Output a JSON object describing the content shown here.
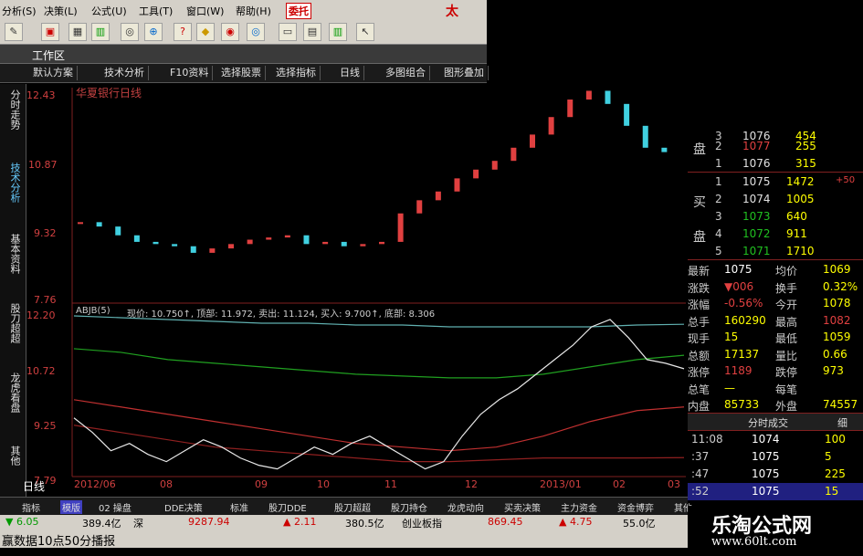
{
  "menu": [
    "分析(S)",
    "决策(L)",
    "公式(U)",
    "工具(T)",
    "窗口(W)",
    "帮助(H)"
  ],
  "menu_highlight": "委托",
  "brand_char": "太",
  "workbar_title": "工作区",
  "func_tabs": [
    "默认方案",
    "技术分析",
    "F10资料",
    "选择股票",
    "选择指标",
    "日线",
    "多图组合",
    "图形叠加"
  ],
  "left_tabs": [
    "分时走势",
    "技术分析",
    "基本资料",
    "股刀超超",
    "龙虎看盘",
    "其他"
  ],
  "chart": {
    "title": "华夏银行日线",
    "price_ticks": [
      "12.43",
      "10.87",
      "9.32",
      "7.76"
    ],
    "ind_ticks": [
      "12.20",
      "10.72",
      "9.25",
      "7.79"
    ],
    "ind_label": "ABJB(5)",
    "ind_values": "现价: 10.750↑, 顶部: 11.972, 卖出: 11.124, 买入: 9.700↑, 底部: 8.306",
    "date_labels": [
      "2012/06",
      "08",
      "09",
      "10",
      "11",
      "12",
      "2013/01",
      "02",
      "03"
    ],
    "period_label": "日线"
  },
  "chart_data": {
    "type": "line",
    "title": "",
    "candles_close": [
      9.4,
      9.3,
      9.1,
      8.95,
      8.9,
      8.85,
      8.7,
      8.8,
      8.9,
      9.0,
      9.05,
      9.1,
      8.9,
      8.95,
      8.85,
      8.9,
      8.95,
      9.6,
      9.9,
      10.1,
      10.4,
      10.6,
      10.8,
      11.1,
      11.4,
      11.8,
      12.2,
      12.4,
      12.1,
      11.6,
      11.1,
      11.0
    ],
    "line_current": [
      9.4,
      9.0,
      8.5,
      8.7,
      8.4,
      8.2,
      8.5,
      8.8,
      8.6,
      8.3,
      8.1,
      8.0,
      8.3,
      8.6,
      8.4,
      8.7,
      8.9,
      8.6,
      8.3,
      8.0,
      8.2,
      8.9,
      9.5,
      9.9,
      10.2,
      10.6,
      11.0,
      11.4,
      11.9,
      12.1,
      11.6,
      11.0,
      10.9,
      10.75
    ],
    "line_top": [
      12.2,
      12.15,
      12.1,
      12.05,
      12.0,
      12.0,
      11.95,
      11.95,
      11.9,
      11.9,
      11.9,
      11.9,
      11.95,
      11.97
    ],
    "line_sell": [
      11.3,
      11.2,
      11.0,
      10.9,
      10.8,
      10.7,
      10.6,
      10.55,
      10.5,
      10.5,
      10.6,
      10.8,
      11.0,
      11.12
    ],
    "line_buy": [
      9.9,
      9.7,
      9.5,
      9.3,
      9.1,
      8.9,
      8.7,
      8.6,
      8.5,
      8.6,
      8.9,
      9.3,
      9.6,
      9.7
    ],
    "line_bottom": [
      9.2,
      9.0,
      8.8,
      8.6,
      8.5,
      8.4,
      8.3,
      8.2,
      8.2,
      8.25,
      8.3,
      8.3,
      8.3,
      8.31
    ],
    "ylim": [
      7.79,
      12.2
    ]
  },
  "quotes": {
    "sell_label": "卖",
    "sell_pan": "盘",
    "sell": [
      [
        "3",
        "1076",
        "454"
      ],
      [
        "2",
        "1077",
        "255"
      ],
      [
        "1",
        "1076",
        "315"
      ]
    ],
    "buy_label": "买",
    "buy_pan": "盘",
    "buy": [
      [
        "1",
        "1075",
        "1472",
        "+50"
      ],
      [
        "2",
        "1074",
        "1005",
        ""
      ],
      [
        "3",
        "1073",
        "640",
        ""
      ],
      [
        "4",
        "1072",
        "911",
        ""
      ],
      [
        "5",
        "1071",
        "1710",
        ""
      ]
    ],
    "stats": [
      [
        "最新",
        "1075",
        "均价",
        "1069"
      ],
      [
        "涨跌",
        "▼006",
        "换手",
        "0.32%"
      ],
      [
        "涨幅",
        "-0.56%",
        "今开",
        "1078"
      ],
      [
        "总手",
        "160290",
        "最高",
        "1082"
      ],
      [
        "现手",
        "15",
        "最低",
        "1059"
      ],
      [
        "总额",
        "17137",
        "量比",
        "0.66"
      ],
      [
        "涨停",
        "1189",
        "跌停",
        "973"
      ],
      [
        "总笔",
        "—",
        "每笔",
        ""
      ],
      [
        "内盘",
        "85733",
        "外盘",
        "74557"
      ]
    ],
    "ticks_header": "分时成交",
    "ticks_detail": "细",
    "ticks": [
      [
        "11:08",
        "1074",
        "100"
      ],
      [
        ":37",
        "1075",
        "5"
      ],
      [
        ":47",
        "1075",
        "225"
      ],
      [
        ":52",
        "1075",
        "15"
      ]
    ]
  },
  "bottom_tabs": [
    "指标",
    "模版",
    "02 操盘",
    "DDE决策",
    "标准",
    "股刀DDE",
    "股刀超超",
    "股刀持仓",
    "龙虎动向",
    "买卖决策",
    "主力资金",
    "资金博弈",
    "其他"
  ],
  "status1": [
    "▼ 6.05",
    "389.4亿",
    "深",
    "9287.94",
    "▲ 2.11",
    "380.5亿",
    "创业板指",
    "869.45",
    "▲ 4.75",
    "55.0亿"
  ],
  "status2": [
    "赢数据10点50分播报"
  ],
  "logo": {
    "title": "乐淘公式网",
    "url": "www.60lt.com"
  }
}
